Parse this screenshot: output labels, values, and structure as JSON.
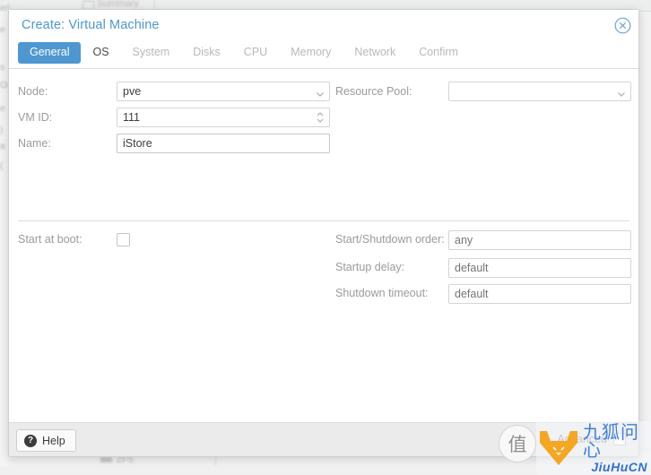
{
  "background": {
    "toolbar_item": "Summary",
    "left_fragments": [
      "er\\",
      "e",
      "s",
      "Os",
      "e",
      ")",
      "a",
      "("
    ],
    "bottom_item": "ZFS"
  },
  "dialog": {
    "title": "Create: Virtual Machine",
    "close_icon": "close-circle-icon",
    "tabs": [
      {
        "label": "General",
        "state": "active"
      },
      {
        "label": "OS",
        "state": "enabled"
      },
      {
        "label": "System",
        "state": "disabled"
      },
      {
        "label": "Disks",
        "state": "disabled"
      },
      {
        "label": "CPU",
        "state": "disabled"
      },
      {
        "label": "Memory",
        "state": "disabled"
      },
      {
        "label": "Network",
        "state": "disabled"
      },
      {
        "label": "Confirm",
        "state": "disabled"
      }
    ],
    "form": {
      "node": {
        "label": "Node:",
        "value": "pve",
        "icon": "chevron-down-icon"
      },
      "vmid": {
        "label": "VM ID:",
        "value": "111",
        "icon": "spinner-updown-icon"
      },
      "name": {
        "label": "Name:",
        "value": "iStore"
      },
      "resource_pool": {
        "label": "Resource Pool:",
        "value": "",
        "placeholder": "",
        "icon": "chevron-down-icon"
      },
      "start_at_boot": {
        "label": "Start at boot:",
        "checked": false
      },
      "startup_order": {
        "label": "Start/Shutdown order:",
        "value": "",
        "placeholder": "any"
      },
      "startup_delay": {
        "label": "Startup delay:",
        "value": "",
        "placeholder": "default"
      },
      "shutdown_timeout": {
        "label": "Shutdown timeout:",
        "value": "",
        "placeholder": "default"
      }
    },
    "footer": {
      "help_label": "Help",
      "help_icon": "question-mark-icon",
      "advanced_label": "Advanced",
      "advanced_checked": false
    }
  },
  "watermark": {
    "badge_char": "值",
    "logo_icon": "fox-head-icon",
    "brand_cn": "九狐问心",
    "brand_en": "JiuHuCN"
  },
  "colors": {
    "accent_blue": "#4e97d1",
    "title_blue": "#4e97d1",
    "label_grey": "#9b9b9b",
    "fox_orange": "#f5a623",
    "brand_blue": "#3d7fe0"
  }
}
